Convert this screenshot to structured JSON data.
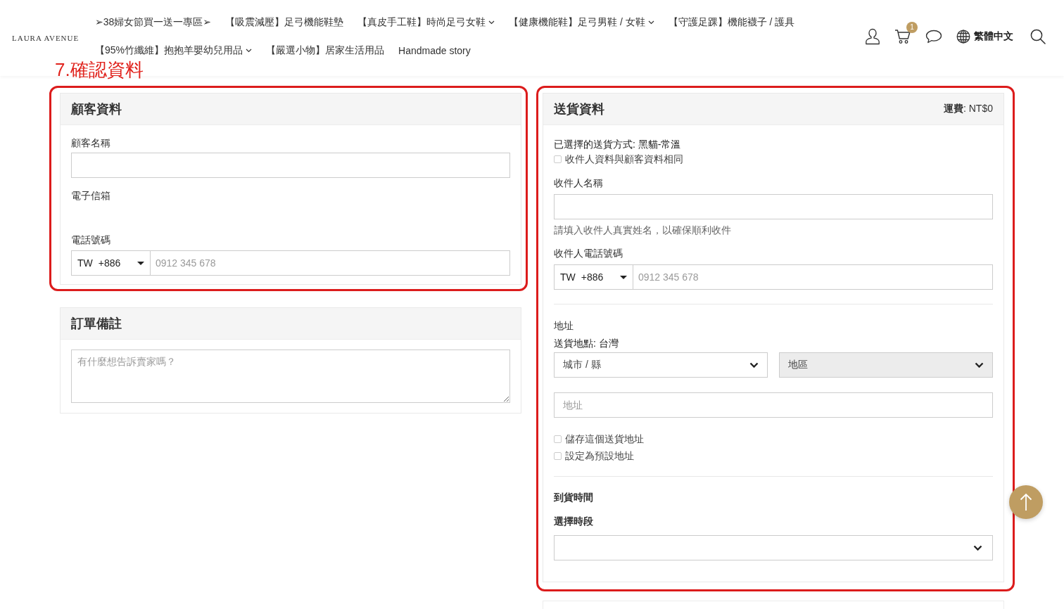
{
  "header": {
    "logo": "LAURA AVENUE",
    "nav_rows": [
      {
        "items": [
          {
            "label": "➢38婦女節買一送一專區➢",
            "has_submenu": false
          },
          {
            "label": "【吸震減壓】足弓機能鞋墊",
            "has_submenu": false
          },
          {
            "label": "【真皮手工鞋】時尚足弓女鞋",
            "has_submenu": true
          },
          {
            "label": "【健康機能鞋】足弓男鞋 / 女鞋",
            "has_submenu": true
          },
          {
            "label": "【守護足踝】機能襪子 / 護具",
            "has_submenu": false
          }
        ]
      },
      {
        "items": [
          {
            "label": "【95%竹纖維】抱抱羊嬰幼兒用品",
            "has_submenu": true
          },
          {
            "label": "【嚴選小物】居家生活用品",
            "has_submenu": false
          },
          {
            "label": "Handmade story",
            "has_submenu": false
          }
        ]
      }
    ],
    "cart_count": "1",
    "language": "繁體中文"
  },
  "annotation": {
    "title": "7.確認資料"
  },
  "customer_card": {
    "title": "顧客資料",
    "highlighted": true,
    "fields": [
      {
        "kind": "input",
        "label": "顧客名稱"
      },
      {
        "kind": "blank",
        "label": "電子信箱"
      },
      {
        "kind": "phone",
        "label": "電話號碼",
        "country": "TW",
        "code": "+886",
        "placeholder": "0912 345 678"
      }
    ]
  },
  "notes_card": {
    "title": "訂單備註",
    "highlighted": false,
    "placeholder": "有什麼想告訴賣家嗎？"
  },
  "delivery_card": {
    "title": "送貨資料",
    "fee": "**運費**: NT$0",
    "highlighted": true,
    "method": "已選擇的送貨方式: 黑貓-常溫",
    "same_as_customer": {
      "label": "收件人資料與顧客資料相同",
      "checked": false
    },
    "recipient_name": {
      "label": "收件人名稱",
      "hint": "請填入收件人真實姓名，以確保順利收件"
    },
    "recipient_phone": {
      "label": "收件人電話號碼",
      "country": "TW",
      "code": "+886",
      "placeholder": "0912 345 678"
    },
    "address": {
      "label": "地址",
      "location": "送貨地點: 台灣",
      "selects": [
        {
          "value": "城市 / 縣",
          "disabled": false
        },
        {
          "value": "地區",
          "disabled": true
        }
      ],
      "placeholder": "地址"
    },
    "options": [
      {
        "label": "儲存這個送貨地址",
        "checked": false
      },
      {
        "label": "設定為預設地址",
        "checked": false
      }
    ],
    "time": {
      "title": "到貨時間",
      "label": "選擇時段"
    }
  }
}
